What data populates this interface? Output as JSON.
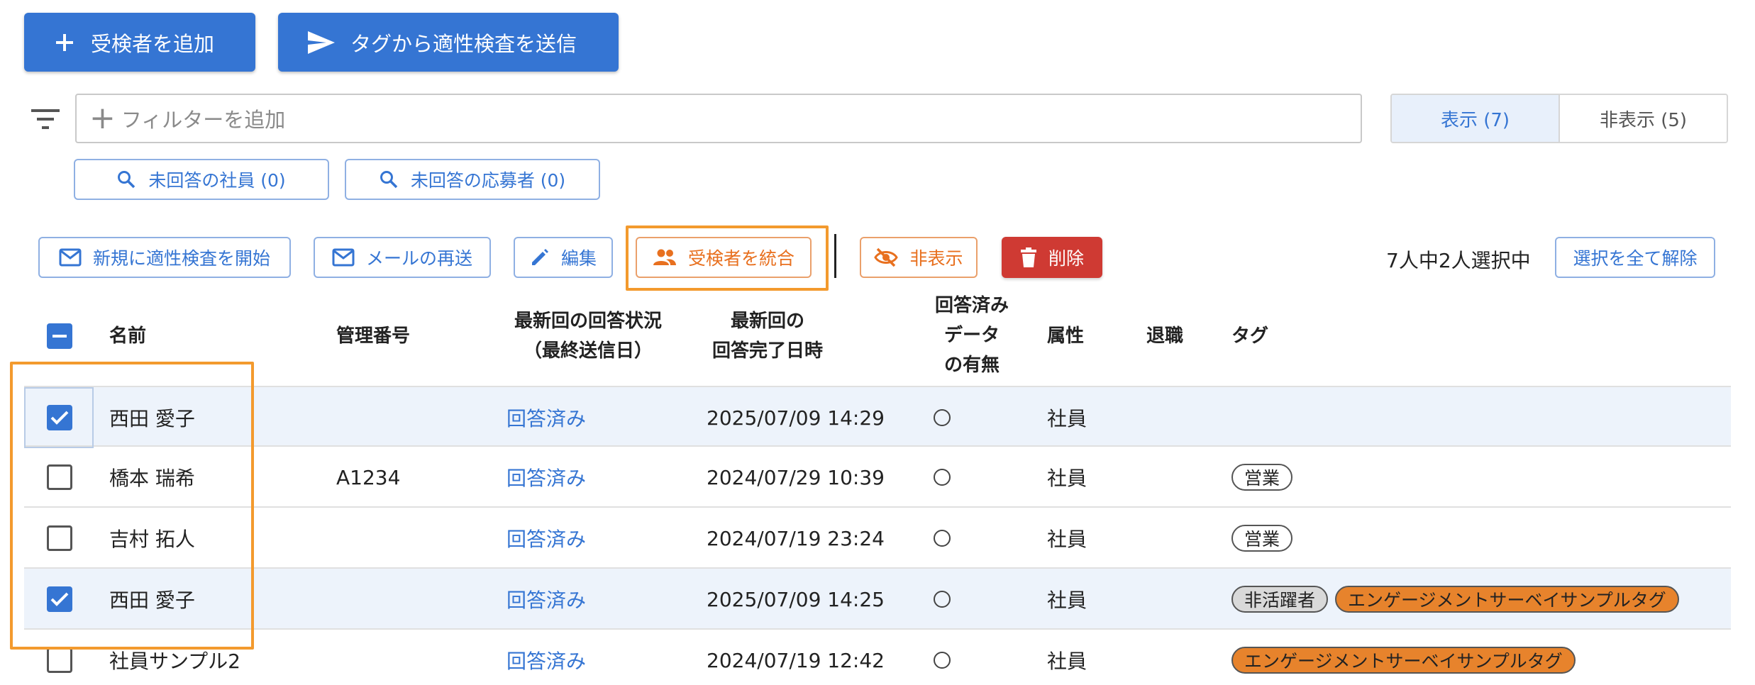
{
  "toolbar": {
    "add_examinee": "受検者を追加",
    "send_from_tag": "タグから適性検査を送信"
  },
  "filter": {
    "placeholder": "フィルターを追加"
  },
  "visibility_toggle": {
    "shown": "表示 (7)",
    "hidden": "非表示 (5)"
  },
  "quick_filters": {
    "unanswered_employees": "未回答の社員 (0)",
    "unanswered_applicants": "未回答の応募者 (0)"
  },
  "actions": {
    "start_new": "新規に適性検査を開始",
    "resend_mail": "メールの再送",
    "edit": "編集",
    "merge": "受検者を統合",
    "hide": "非表示",
    "delete": "削除"
  },
  "selection": {
    "count_text": "7人中2人選択中",
    "clear_all": "選択を全て解除"
  },
  "table": {
    "headers": {
      "name": "名前",
      "management_no": "管理番号",
      "status_line1": "最新回の回答状況",
      "status_line2": "（最終送信日）",
      "completed_line1": "最新回の",
      "completed_line2": "回答完了日時",
      "data_line1": "回答済み",
      "data_line2": "データ",
      "data_line3": "の有無",
      "attribute": "属性",
      "retired": "退職",
      "tags": "タグ"
    },
    "rows": [
      {
        "checked": true,
        "name": "西田 愛子",
        "management_no": "",
        "status": "回答済み",
        "completed_at": "2025/07/09 14:29",
        "has_data": "○",
        "attribute": "社員",
        "retired": "",
        "tags": []
      },
      {
        "checked": false,
        "name": "橋本 瑞希",
        "management_no": "A1234",
        "status": "回答済み",
        "completed_at": "2024/07/29 10:39",
        "has_data": "○",
        "attribute": "社員",
        "retired": "",
        "tags": [
          "営業"
        ]
      },
      {
        "checked": false,
        "name": "吉村 拓人",
        "management_no": "",
        "status": "回答済み",
        "completed_at": "2024/07/19 23:24",
        "has_data": "○",
        "attribute": "社員",
        "retired": "",
        "tags": [
          "営業"
        ]
      },
      {
        "checked": true,
        "name": "西田 愛子",
        "management_no": "",
        "status": "回答済み",
        "completed_at": "2025/07/09 14:25",
        "has_data": "○",
        "attribute": "社員",
        "retired": "",
        "tags": [
          "非活躍者",
          "エンゲージメントサーベイサンプルタグ"
        ]
      },
      {
        "checked": false,
        "name": "社員サンプル2",
        "management_no": "",
        "status": "回答済み",
        "completed_at": "2024/07/19 12:42",
        "has_data": "○",
        "attribute": "社員",
        "retired": "",
        "tags": [
          "エンゲージメントサーベイサンプルタグ"
        ]
      }
    ]
  },
  "colors": {
    "primary": "#3575d3",
    "highlight": "#f39a2e",
    "danger": "#cf3a33",
    "tag_orange": "#e7832c"
  }
}
